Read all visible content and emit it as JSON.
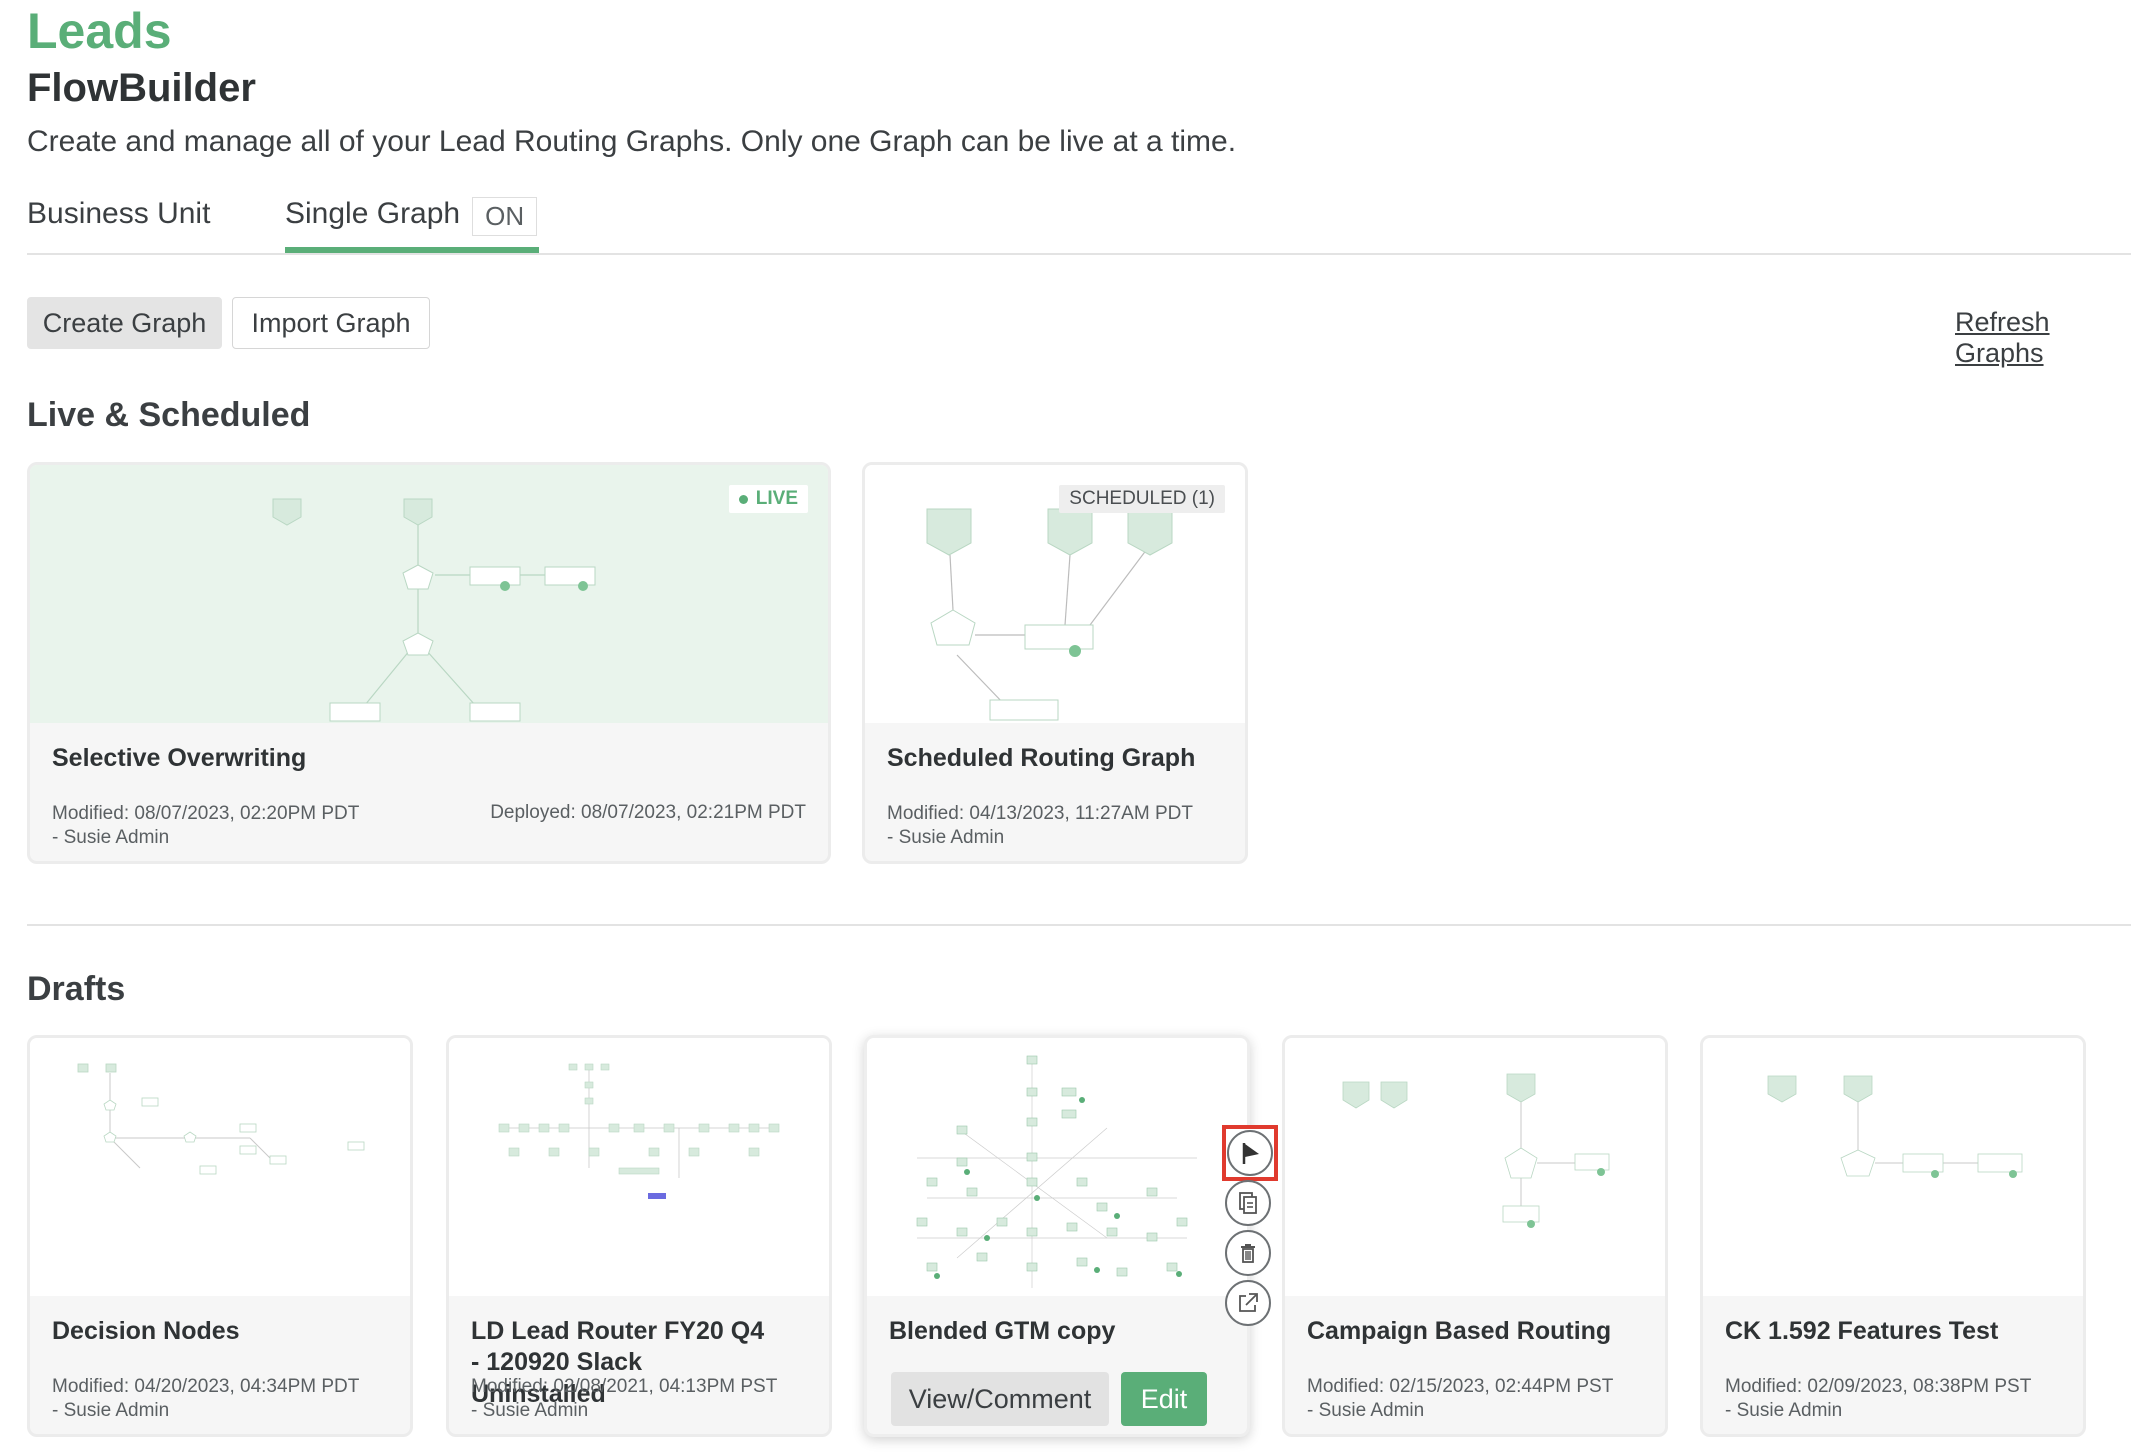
{
  "header": {
    "app_title": "Leads",
    "page_title": "FlowBuilder",
    "description": "Create and manage all of your Lead Routing Graphs. Only one Graph can be live at a time."
  },
  "tabs": {
    "business_unit": "Business Unit",
    "single_graph": "Single Graph",
    "single_graph_badge": "ON"
  },
  "toolbar": {
    "create_label": "Create Graph",
    "import_label": "Import Graph",
    "refresh_label": "Refresh Graphs"
  },
  "live_section": {
    "title": "Live & Scheduled",
    "cards": [
      {
        "name": "Selective Overwriting",
        "badge": "LIVE",
        "modified": "Modified: 08/07/2023, 02:20PM PDT",
        "author": "- Susie Admin",
        "deployed": "Deployed: 08/07/2023, 02:21PM PDT"
      },
      {
        "name": "Scheduled Routing Graph",
        "badge": "SCHEDULED (1)",
        "modified": "Modified: 04/13/2023, 11:27AM PDT",
        "author": "- Susie Admin"
      }
    ]
  },
  "drafts_section": {
    "title": "Drafts",
    "cards": [
      {
        "name": "Decision Nodes",
        "modified": "Modified: 04/20/2023, 04:34PM PDT",
        "author": "- Susie Admin"
      },
      {
        "name": "LD Lead Router FY20 Q4 - 120920 Slack Uninstalled",
        "modified": "Modified: 02/08/2021, 04:13PM PST",
        "author": "- Susie Admin"
      },
      {
        "name": "Blended GTM copy",
        "view_label": "View/Comment",
        "edit_label": "Edit"
      },
      {
        "name": "Campaign Based Routing",
        "modified": "Modified: 02/15/2023, 02:44PM PST",
        "author": "- Susie Admin"
      },
      {
        "name": "CK 1.592 Features Test",
        "modified": "Modified: 02/09/2023, 08:38PM PST",
        "author": "- Susie Admin"
      }
    ]
  },
  "card_actions": {
    "icons": [
      "flag-icon",
      "copy-icon",
      "trash-icon",
      "export-icon"
    ]
  },
  "colors": {
    "brand_green": "#5aae78",
    "highlight_red": "#e03a2e",
    "live_thumb_bg": "#e9f4ec"
  }
}
